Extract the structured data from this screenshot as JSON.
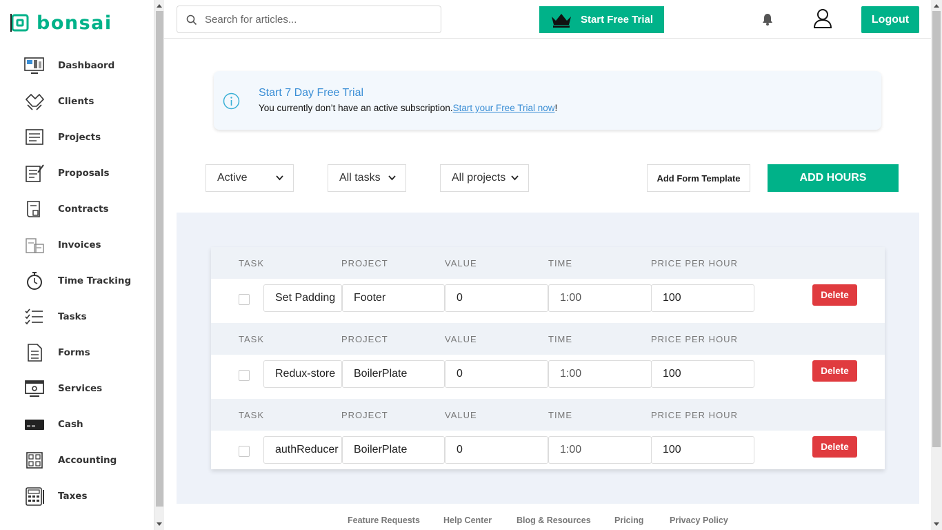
{
  "brand": {
    "name": "bonsai"
  },
  "sidebar": {
    "items": [
      {
        "label": "Dashbaord",
        "icon": "dashboard-icon"
      },
      {
        "label": "Clients",
        "icon": "clients-icon"
      },
      {
        "label": "Projects",
        "icon": "projects-icon"
      },
      {
        "label": "Proposals",
        "icon": "proposals-icon"
      },
      {
        "label": "Contracts",
        "icon": "contracts-icon"
      },
      {
        "label": "Invoices",
        "icon": "invoices-icon"
      },
      {
        "label": "Time Tracking",
        "icon": "stopwatch-icon"
      },
      {
        "label": "Tasks",
        "icon": "tasks-icon"
      },
      {
        "label": "Forms",
        "icon": "forms-icon"
      },
      {
        "label": "Services",
        "icon": "services-icon"
      },
      {
        "label": "Cash",
        "icon": "cash-icon"
      },
      {
        "label": "Accounting",
        "icon": "accounting-icon"
      },
      {
        "label": "Taxes",
        "icon": "taxes-icon"
      }
    ]
  },
  "header": {
    "search_placeholder": "Search for articles...",
    "trial_button": "Start Free Trial",
    "logout": "Logout"
  },
  "alert": {
    "title": "Start 7 Day Free Trial",
    "message": "You currently don’t have an active subscription.",
    "link": "Start your Free Trial now",
    "suffix": "!"
  },
  "filters": {
    "status": "Active",
    "tasks": "All tasks",
    "projects": "All projects",
    "form_template": "Add Form Template",
    "add_hours": "ADD HOURS"
  },
  "table": {
    "headers": [
      "TASK",
      "PROJECT",
      "VALUE",
      "TIME",
      "PRICE PER HOUR"
    ],
    "delete_label": "Delete",
    "rows": [
      {
        "task": "Set Padding",
        "project": "Footer",
        "value": "0",
        "time": "1:00",
        "price": "100"
      },
      {
        "task": "Redux-store",
        "project": "BoilerPlate",
        "value": "0",
        "time": "1:00",
        "price": "100"
      },
      {
        "task": "authReducer",
        "project": "BoilerPlate",
        "value": "0",
        "time": "1:00",
        "price": "100"
      }
    ]
  },
  "footer": {
    "links": [
      "Feature Requests",
      "Help Center",
      "Blog & Resources",
      "Pricing",
      "Privacy Policy"
    ]
  },
  "colors": {
    "accent": "#00b289",
    "danger": "#e03b3f",
    "link": "#3a8ed5"
  }
}
